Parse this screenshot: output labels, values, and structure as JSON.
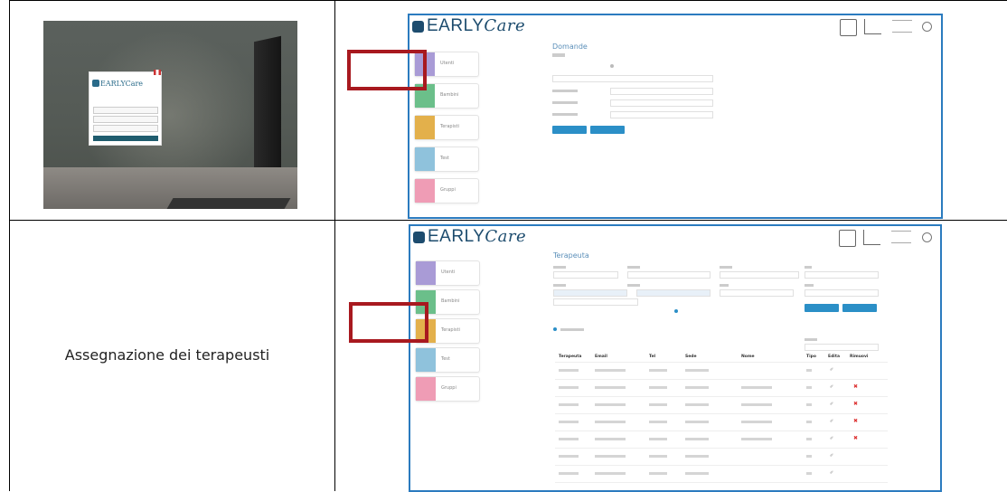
{
  "caption": "Assegnazione dei terapeusti",
  "colors": {
    "frame_border": "#2b7bbf",
    "highlight": "#a8191f",
    "brand": "#1d4c6e",
    "accent_button": "#2b8fc7"
  },
  "logo": {
    "main": "EARLY",
    "script": "Care"
  },
  "login_box": {
    "logo": "EARLYCare"
  },
  "screen1": {
    "title": "Domande",
    "sidebar": [
      {
        "label": "Utenti",
        "color": "#a99bd6",
        "icon": "user-icon"
      },
      {
        "label": "Bambini",
        "color": "#6bbf8a",
        "icon": "child-icon"
      },
      {
        "label": "Terapisti",
        "color": "#e3b04b",
        "icon": "therapist-icon"
      },
      {
        "label": "Test",
        "color": "#8fc2dc",
        "icon": "test-icon"
      },
      {
        "label": "Gruppi",
        "color": "#ef9cb5",
        "icon": "group-icon"
      }
    ]
  },
  "screen2": {
    "title": "Terapeuta",
    "sidebar": [
      {
        "label": "Utenti",
        "color": "#a99bd6",
        "icon": "user-icon"
      },
      {
        "label": "Bambini",
        "color": "#6bbf8a",
        "icon": "child-icon"
      },
      {
        "label": "Terapisti",
        "color": "#e3b04b",
        "icon": "therapist-icon"
      },
      {
        "label": "Test",
        "color": "#8fc2dc",
        "icon": "test-icon"
      },
      {
        "label": "Gruppi",
        "color": "#ef9cb5",
        "icon": "group-icon"
      }
    ],
    "table": {
      "headers": [
        "Terapeuta",
        "Email",
        "Tel",
        "Sede",
        "Nome",
        "Tipo",
        "Edita",
        "Rimuovi"
      ],
      "rows": [
        {
          "remove": false
        },
        {
          "remove": true
        },
        {
          "remove": true
        },
        {
          "remove": true
        },
        {
          "remove": true
        },
        {
          "remove": false
        },
        {
          "remove": false
        }
      ]
    }
  }
}
